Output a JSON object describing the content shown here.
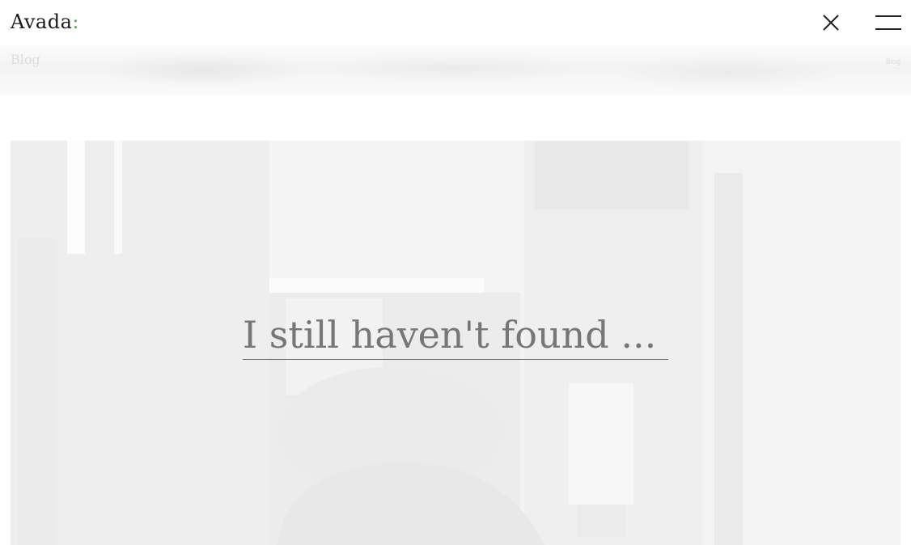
{
  "header": {
    "logo_text": "Avada",
    "logo_colon": ":",
    "close_icon": "close-icon",
    "menu_icon": "hamburger-menu-icon",
    "accent_color": "#4ab04a"
  },
  "titlebar": {
    "page_title": "Blog",
    "breadcrumb": "Blog"
  },
  "search": {
    "placeholder": "I still haven't found ...",
    "value": ""
  },
  "hero": {
    "background": "faded-monochrome-photo"
  }
}
